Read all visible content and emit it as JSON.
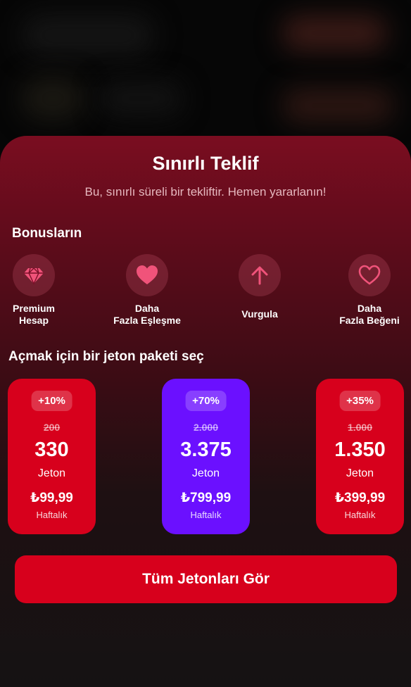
{
  "offer": {
    "title": "Sınırlı Teklif",
    "subtitle": "Bu, sınırlı süreli bir tekliftir. Hemen yararlanın!"
  },
  "bonuses": {
    "heading": "Bonusların",
    "items": [
      {
        "label": "Premium\nHesap",
        "icon": "diamond-icon"
      },
      {
        "label": "Daha\nFazla Eşleşme",
        "icon": "heart-filled-icon"
      },
      {
        "label": "Vurgula",
        "icon": "arrow-up-icon"
      },
      {
        "label": "Daha\nFazla Beğeni",
        "icon": "heart-outline-icon"
      }
    ]
  },
  "packages": {
    "heading": "Açmak için bir jeton paketi seç",
    "items": [
      {
        "badge": "+10%",
        "old": "200",
        "amount": "330",
        "unit": "Jeton",
        "price": "₺99,99",
        "period": "Haftalık",
        "color": "#d7001c"
      },
      {
        "badge": "+70%",
        "old": "2.000",
        "amount": "3.375",
        "unit": "Jeton",
        "price": "₺799,99",
        "period": "Haftalık",
        "color": "#6b10ff"
      },
      {
        "badge": "+35%",
        "old": "1.000",
        "amount": "1.350",
        "unit": "Jeton",
        "price": "₺399,99",
        "period": "Haftalık",
        "color": "#d7001c"
      }
    ]
  },
  "cta": {
    "label": "Tüm Jetonları Gör"
  },
  "colors": {
    "accent_red": "#d7001c",
    "accent_purple": "#6b10ff",
    "icon_pink": "#f0537a"
  }
}
